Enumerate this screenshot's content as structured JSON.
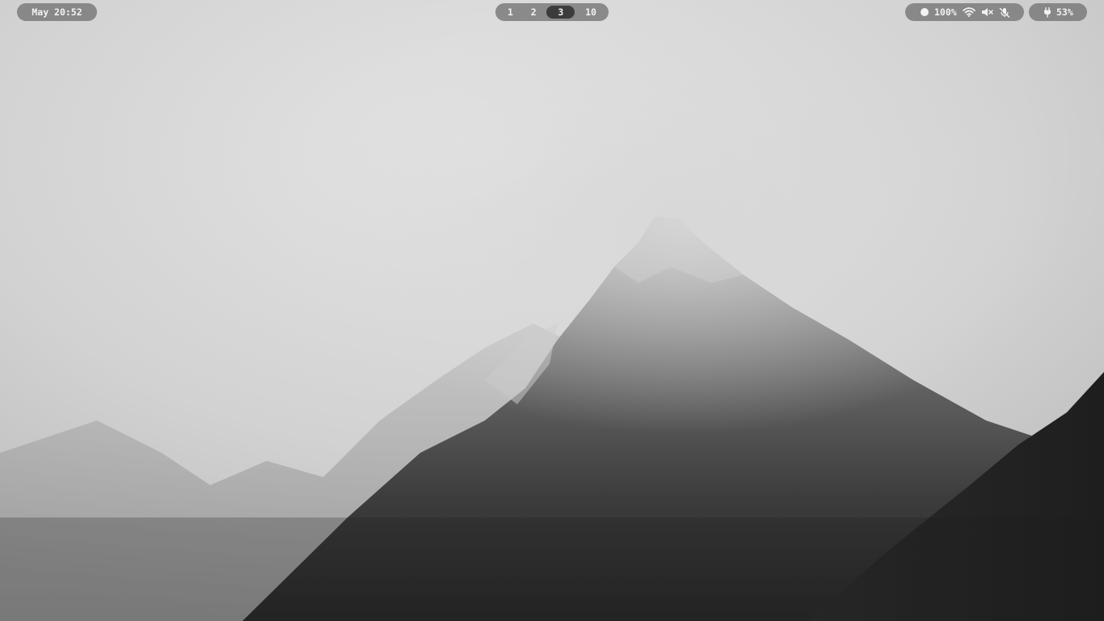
{
  "clock": {
    "text": "May 20:52"
  },
  "workspaces": [
    {
      "label": "1",
      "active": false
    },
    {
      "label": "2",
      "active": false
    },
    {
      "label": "3",
      "active": true
    },
    {
      "label": "10",
      "active": false
    }
  ],
  "status": {
    "brightness_icon": "circle-dot-icon",
    "brightness_value": "100%",
    "wifi_icon": "wifi-icon",
    "volume_icon": "volume-muted-icon",
    "mic_icon": "mic-muted-icon"
  },
  "battery": {
    "icon": "plug-icon",
    "value": "53%"
  },
  "colors": {
    "pill_bg": "#787878",
    "active_ws": "#3c3c3c",
    "text": "#f2f2f2"
  }
}
